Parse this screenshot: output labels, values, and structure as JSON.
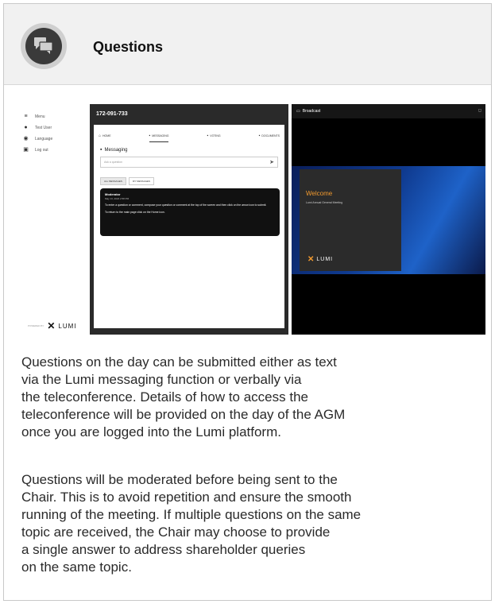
{
  "header": {
    "title": "Questions",
    "icon": "chat-bubbles-icon"
  },
  "screenshot": {
    "sidebar": {
      "items": [
        {
          "icon": "menu-icon",
          "label": "Menu"
        },
        {
          "icon": "user-icon",
          "label": "Test User"
        },
        {
          "icon": "globe-icon",
          "label": "Language"
        },
        {
          "icon": "logout-icon",
          "label": "Log out"
        }
      ],
      "powered_by": "POWERED BY",
      "logo": "LUMI"
    },
    "messaging": {
      "meeting_id": "172-091-733",
      "tabs": [
        "HOME",
        "MESSAGING",
        "VOTING",
        "DOCUMENTS"
      ],
      "panel_title": "Messaging",
      "ask_placeholder": "Ask a question",
      "message_tabs": [
        "ALL MESSAGES",
        "MY MESSAGES"
      ],
      "moderator": {
        "name": "Moderator",
        "date": "May 13, 2024 2:58 PM",
        "text1": "To enter a question or comment, compose your question or comment at the top of the screen and then click on the arrow icon to submit.",
        "text2": "To return to the main page click on the Home icon."
      }
    },
    "broadcast": {
      "title": "Broadcast",
      "slide_title": "Welcome",
      "slide_subtitle": "Lumi Annual General Meeting",
      "slide_logo": "LUMI"
    }
  },
  "paragraphs": {
    "p1": [
      "Questions on the day can be submitted either as text",
      "via the Lumi messaging function or verbally via",
      "the teleconference. Details of how to access the",
      "teleconference will be provided on the day of the AGM",
      "once you are logged into the Lumi platform."
    ],
    "p2": [
      "Questions will be moderated before being sent to the",
      "Chair. This is to avoid repetition and ensure the smooth",
      "running of the meeting. If multiple questions on the same",
      "topic are received, the Chair may choose to provide",
      "a single answer to address shareholder queries",
      "on the same topic."
    ]
  },
  "colors": {
    "header_bg": "#f1f1f1",
    "accent_orange": "#f29a2e",
    "dark": "#111111"
  }
}
